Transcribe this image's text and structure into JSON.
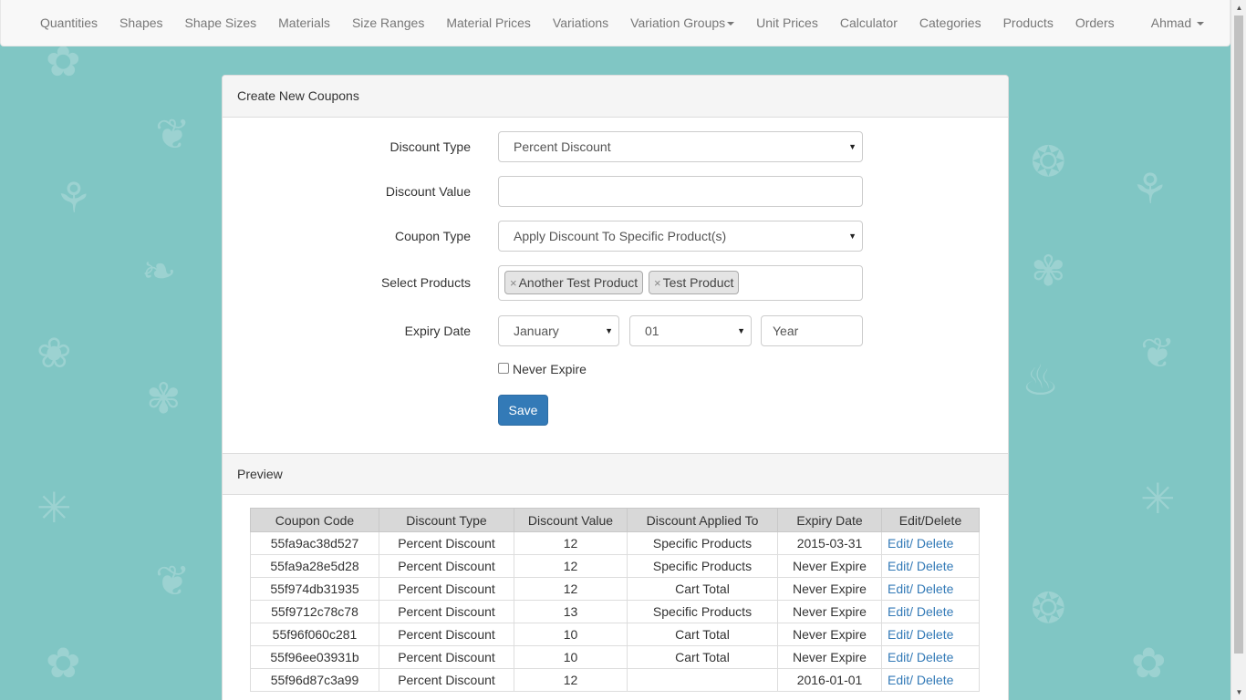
{
  "navbar": {
    "items": [
      {
        "label": "Quantities"
      },
      {
        "label": "Shapes"
      },
      {
        "label": "Shape Sizes"
      },
      {
        "label": "Materials"
      },
      {
        "label": "Size Ranges"
      },
      {
        "label": "Material Prices"
      },
      {
        "label": "Variations"
      },
      {
        "label": "Variation Groups",
        "dropdown": true
      },
      {
        "label": "Unit Prices"
      },
      {
        "label": "Calculator"
      },
      {
        "label": "Categories"
      },
      {
        "label": "Products"
      },
      {
        "label": "Orders"
      }
    ],
    "user": "Ahmad"
  },
  "panel": {
    "title": "Create New Coupons",
    "preview_title": "Preview"
  },
  "form": {
    "discount_type": {
      "label": "Discount Type",
      "value": "Percent Discount"
    },
    "discount_value": {
      "label": "Discount Value",
      "value": ""
    },
    "coupon_type": {
      "label": "Coupon Type",
      "value": "Apply Discount To Specific Product(s)"
    },
    "select_products": {
      "label": "Select Products",
      "tags": [
        "Another Test Product",
        "Test Product"
      ],
      "remove_glyph": "×"
    },
    "expiry_date": {
      "label": "Expiry Date",
      "month": "January",
      "day": "01",
      "year_placeholder": "Year"
    },
    "never_expire": {
      "label": "Never Expire",
      "checked": false
    },
    "save_label": "Save"
  },
  "table": {
    "headers": [
      "Coupon Code",
      "Discount Type",
      "Discount Value",
      "Discount Applied To",
      "Expiry Date",
      "Edit/Delete"
    ],
    "edit_label": "Edit/",
    "delete_label": "Delete",
    "rows": [
      [
        "55fa9ac38d527",
        "Percent Discount",
        "12",
        "Specific Products",
        "2015-03-31"
      ],
      [
        "55fa9a28e5d28",
        "Percent Discount",
        "12",
        "Specific Products",
        "Never Expire"
      ],
      [
        "55f974db31935",
        "Percent Discount",
        "12",
        "Cart Total",
        "Never Expire"
      ],
      [
        "55f9712c78c78",
        "Percent Discount",
        "13",
        "Specific Products",
        "Never Expire"
      ],
      [
        "55f96f060c281",
        "Percent Discount",
        "10",
        "Cart Total",
        "Never Expire"
      ],
      [
        "55f96ee03931b",
        "Percent Discount",
        "10",
        "Cart Total",
        "Never Expire"
      ],
      [
        "55f96d87c3a99",
        "Percent Discount",
        "12",
        "",
        "2016-01-01"
      ]
    ]
  },
  "colors": {
    "background": "#80c6c4",
    "primary": "#337ab7",
    "link": "#337ab7"
  }
}
